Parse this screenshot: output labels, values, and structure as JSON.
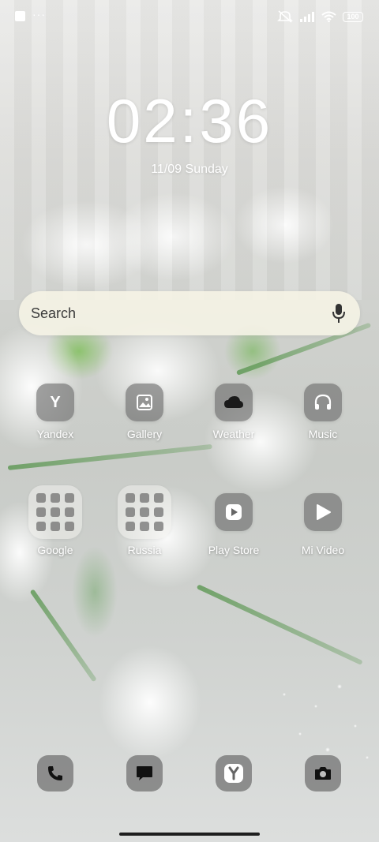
{
  "status_bar": {
    "overflow_dots": "···",
    "battery_level": "100",
    "icons": [
      "notification-square-icon",
      "mute-icon",
      "signal-icon",
      "wifi-icon",
      "battery-icon"
    ]
  },
  "lock": {
    "time": "02:36",
    "date": "11/09 Sunday"
  },
  "search": {
    "label": "Search",
    "icon": "microphone-icon"
  },
  "apps_row1": [
    {
      "label": "Yandex",
      "icon": "yandex-icon"
    },
    {
      "label": "Gallery",
      "icon": "gallery-icon"
    },
    {
      "label": "Weather",
      "icon": "weather-icon"
    },
    {
      "label": "Music",
      "icon": "headphones-icon"
    }
  ],
  "apps_row2": [
    {
      "label": "Google",
      "icon": "folder-icon"
    },
    {
      "label": "Russia",
      "icon": "folder-icon"
    },
    {
      "label": "Play Store",
      "icon": "play-store-icon"
    },
    {
      "label": "Mi Video",
      "icon": "mi-video-icon"
    }
  ],
  "dock": [
    "phone-icon",
    "messages-icon",
    "yandex-browser-icon",
    "camera-icon"
  ],
  "colors": {
    "accent_text": "#ffffff",
    "tile": "#696969",
    "search_bg": "#f6f4e6"
  }
}
